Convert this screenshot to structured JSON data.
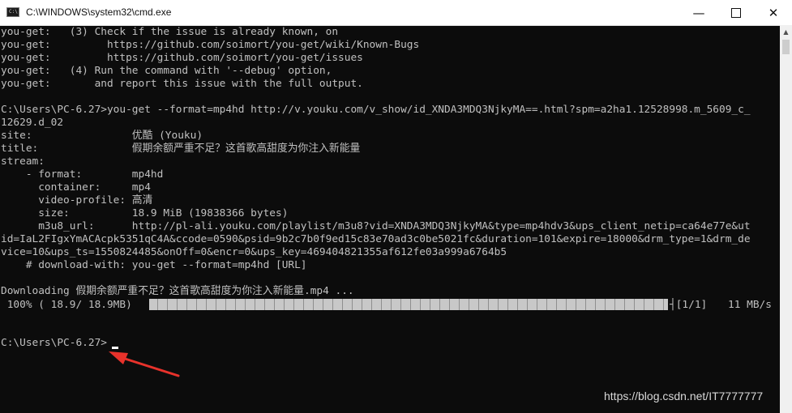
{
  "window": {
    "title": "C:\\WINDOWS\\system32\\cmd.exe",
    "app_icon_text": "C:\\",
    "minimize_glyph": "—",
    "close_glyph": "✕"
  },
  "console": {
    "lines": [
      "you-get:   (3) Check if the issue is already known, on",
      "you-get:         https://github.com/soimort/you-get/wiki/Known-Bugs",
      "you-get:         https://github.com/soimort/you-get/issues",
      "you-get:   (4) Run the command with '--debug' option,",
      "you-get:       and report this issue with the full output.",
      "",
      "C:\\Users\\PC-6.27>you-get --format=mp4hd http://v.youku.com/v_show/id_XNDA3MDQ3NjkyMA==.html?spm=a2ha1.12528998.m_5609_c_",
      "12629.d_02",
      "site:                优酷 (Youku)",
      "title:               假期余额严重不足？这首歌高甜度为你注入新能量",
      "stream:",
      "    - format:        mp4hd",
      "      container:     mp4",
      "      video-profile: 高清",
      "      size:          18.9 MiB (19838366 bytes)",
      "      m3u8_url:      http://pl-ali.youku.com/playlist/m3u8?vid=XNDA3MDQ3NjkyMA&type=mp4hdv3&ups_client_netip=ca64e77e&ut",
      "id=IaL2FIgxYmACAcpk5351qC4A&ccode=0590&psid=9b2c7b0f9ed15c83e70ad3c0be5021fc&duration=101&expire=18000&drm_type=1&drm_de",
      "vice=10&ups_ts=1550824485&onOff=0&encr=0&ups_key=469404821355af612fe03a999a6764b5",
      "    # download-with: you-get --format=mp4hd [URL]",
      "",
      "Downloading 假期余额严重不足？这首歌高甜度为你注入新能量.mp4 ..."
    ],
    "progress": {
      "percent_label": " 100% ( 18.9/ 18.9MB)",
      "parts_label": "[1/1]",
      "speed_label": "11 MB/s",
      "fraction": 1.0
    },
    "prompt": "C:\\Users\\PC-6.27>"
  },
  "watermark": "https://blog.csdn.net/IT7777777"
}
